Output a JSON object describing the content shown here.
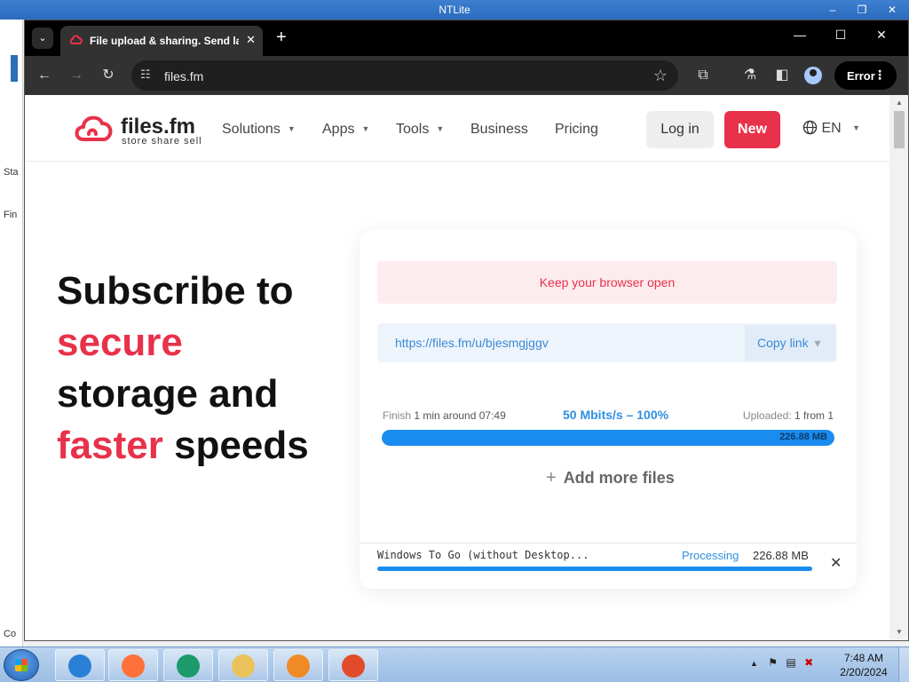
{
  "outer_window": {
    "title": "NTLite",
    "minimize": "–",
    "restore": "❐",
    "close": "✕",
    "side_labels": [
      "Sta",
      "Fin",
      "Co"
    ]
  },
  "browser": {
    "tab_title": "File upload & sharing. Send large files",
    "tab_close": "✕",
    "new_tab": "+",
    "tab_search": "⌄",
    "win_min": "—",
    "win_max": "☐",
    "win_close": "✕",
    "back": "←",
    "forward": "→",
    "reload": "↻",
    "url": "files.fm",
    "site_info": "☷",
    "bookmark": "☆",
    "extensions": "⧉",
    "labs": "⚗",
    "side_panel": "◧",
    "error_label": "Error",
    "menu_dots": "⋮"
  },
  "site": {
    "logo_name": "files.fm",
    "logo_tagline": "store share sell",
    "nav": [
      {
        "label": "Solutions",
        "dropdown": true
      },
      {
        "label": "Apps",
        "dropdown": true
      },
      {
        "label": "Tools",
        "dropdown": true
      },
      {
        "label": "Business",
        "dropdown": false
      },
      {
        "label": "Pricing",
        "dropdown": false
      }
    ],
    "caret": "▼",
    "login_label": "Log in",
    "new_label": "New",
    "language": "EN",
    "globe": "🌐",
    "brand_color": "#e8314a",
    "accent_blue": "#1a8cf0"
  },
  "hero": {
    "line1": "Subscribe to",
    "line2": "secure",
    "line3": "storage and",
    "line4_accent": "faster",
    "line4_rest": " speeds"
  },
  "upload": {
    "notice": "Keep your browser open",
    "share_url": "https://files.fm/u/bjesmgjggv",
    "copy_link_label": "Copy link",
    "copy_caret": "▾",
    "finish_label": "Finish",
    "finish_value": "1 min around 07:49",
    "speed": "50 Mbits/s – 100%",
    "uploaded_label": "Uploaded:",
    "uploaded_value": "1 from 1",
    "progress_percent": 100,
    "progress_size": "226.88 MB",
    "add_more_plus": "+",
    "add_more_label": "Add more files",
    "file": {
      "name": "Windows To Go (without Desktop...",
      "status": "Processing",
      "size": "226.88 MB",
      "close": "✕",
      "progress_percent": 100
    }
  },
  "taskbar": {
    "time": "7:48 AM",
    "date": "2/20/2024",
    "tray_arrow": "▲",
    "apps": [
      {
        "name": "internet-explorer",
        "color": "#2a7fd6"
      },
      {
        "name": "firefox",
        "color": "#ff7139"
      },
      {
        "name": "browser-green",
        "color": "#1b9a6b"
      },
      {
        "name": "file-explorer",
        "color": "#e9c35a"
      },
      {
        "name": "media-player",
        "color": "#f08a24"
      },
      {
        "name": "ntlite",
        "color": "#e24b2a"
      }
    ]
  }
}
